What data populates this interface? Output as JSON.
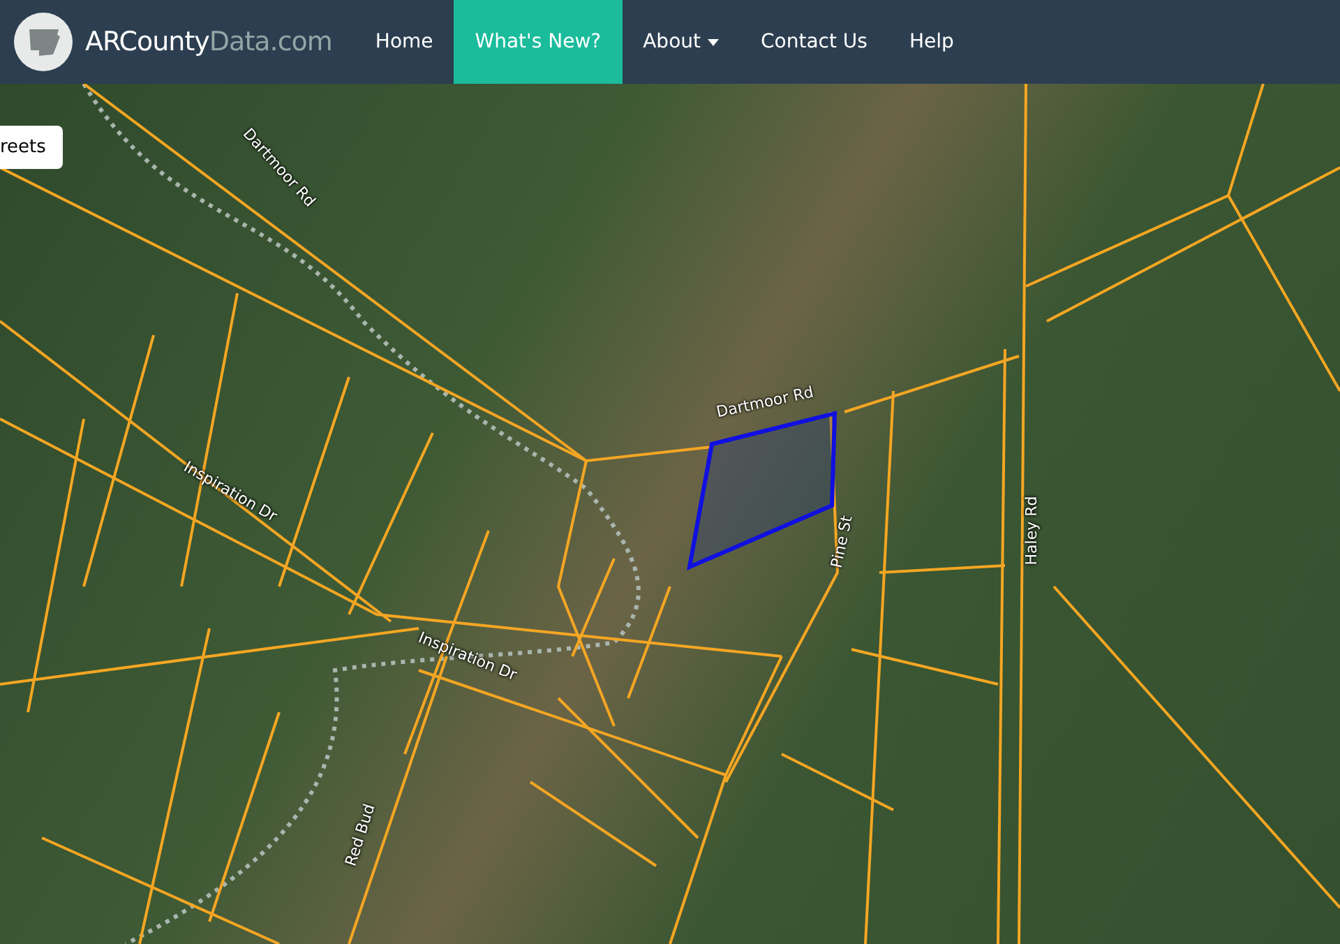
{
  "navbar": {
    "brand": {
      "primary": "ARCounty",
      "secondary": "Data.com"
    },
    "items": [
      {
        "label": "Home",
        "selected": false,
        "dropdown": false
      },
      {
        "label": "What's New?",
        "selected": true,
        "dropdown": false
      },
      {
        "label": "About",
        "selected": false,
        "dropdown": true
      },
      {
        "label": "Contact Us",
        "selected": false,
        "dropdown": false
      },
      {
        "label": "Help",
        "selected": false,
        "dropdown": false
      }
    ]
  },
  "map": {
    "layer_button": "reets",
    "road_labels": [
      "Dartmoor Rd",
      "Dartmoor Rd",
      "Inspiration Dr",
      "Inspiration Dr",
      "Pine St",
      "Haley Rd",
      "Red Bud"
    ]
  }
}
